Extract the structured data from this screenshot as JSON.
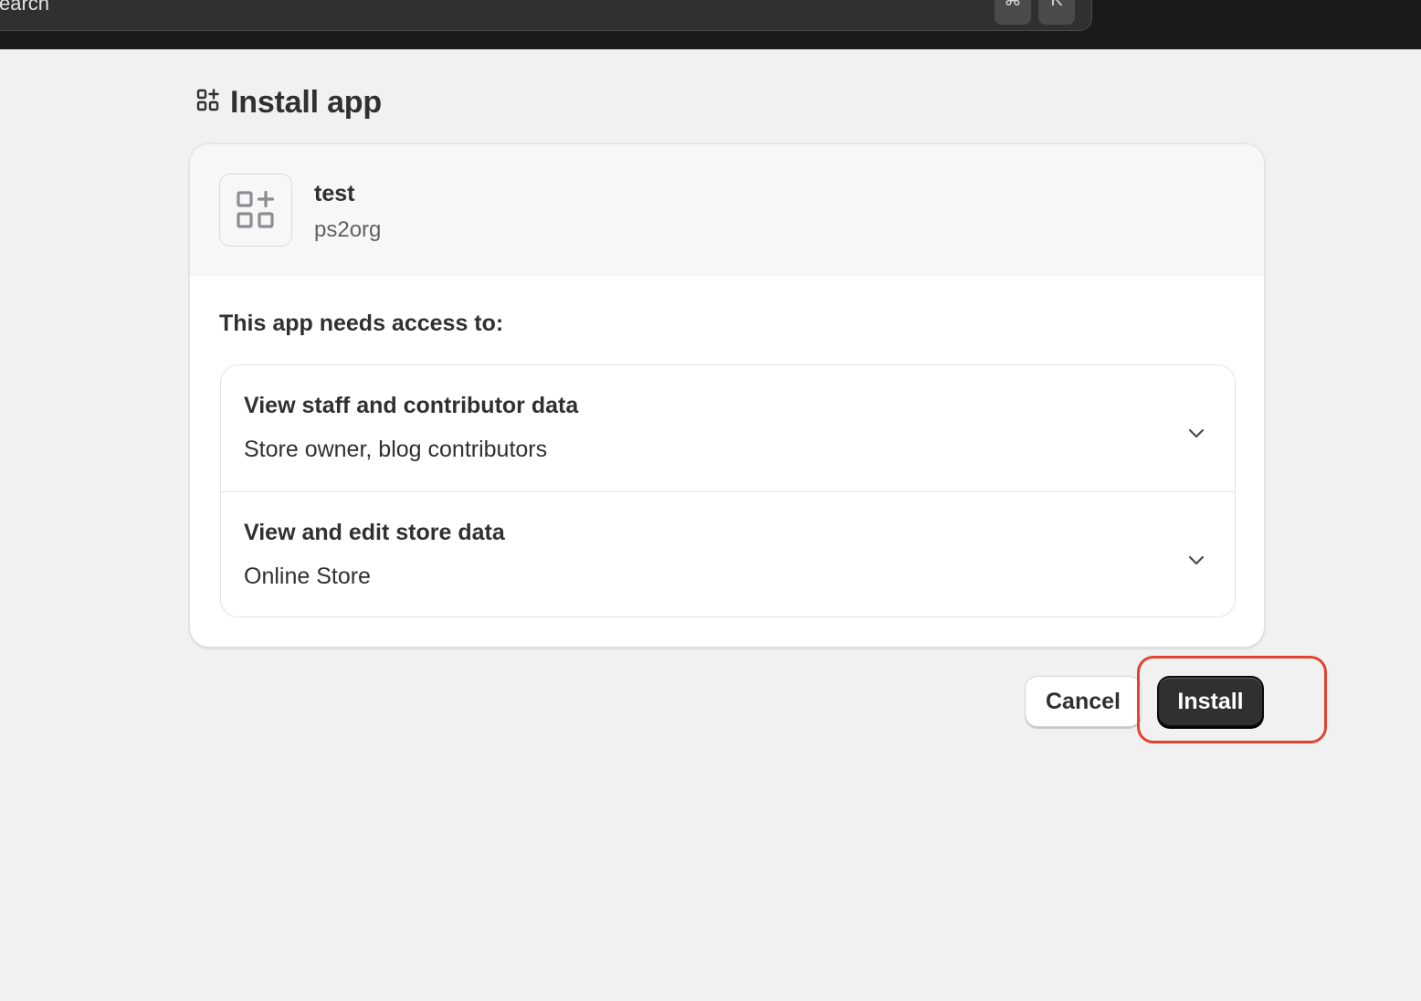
{
  "topbar": {
    "search_text": "earch",
    "shortcut_cmd": "⌘",
    "shortcut_key": "K"
  },
  "page": {
    "title": "Install app",
    "title_icon": "apps-add-icon"
  },
  "app": {
    "name": "test",
    "developer": "ps2org",
    "icon": "apps-add-icon"
  },
  "access": {
    "heading": "This app needs access to:",
    "permissions": [
      {
        "title": "View staff and contributor data",
        "description": "Store owner, blog contributors",
        "icon": "chevron-down-icon"
      },
      {
        "title": "View and edit store data",
        "description": "Online Store",
        "icon": "chevron-down-icon"
      }
    ]
  },
  "actions": {
    "cancel_label": "Cancel",
    "install_label": "Install"
  },
  "colors": {
    "highlight": "#e0442e",
    "primary_button": "#303030",
    "topbar": "#1a1a1a"
  }
}
